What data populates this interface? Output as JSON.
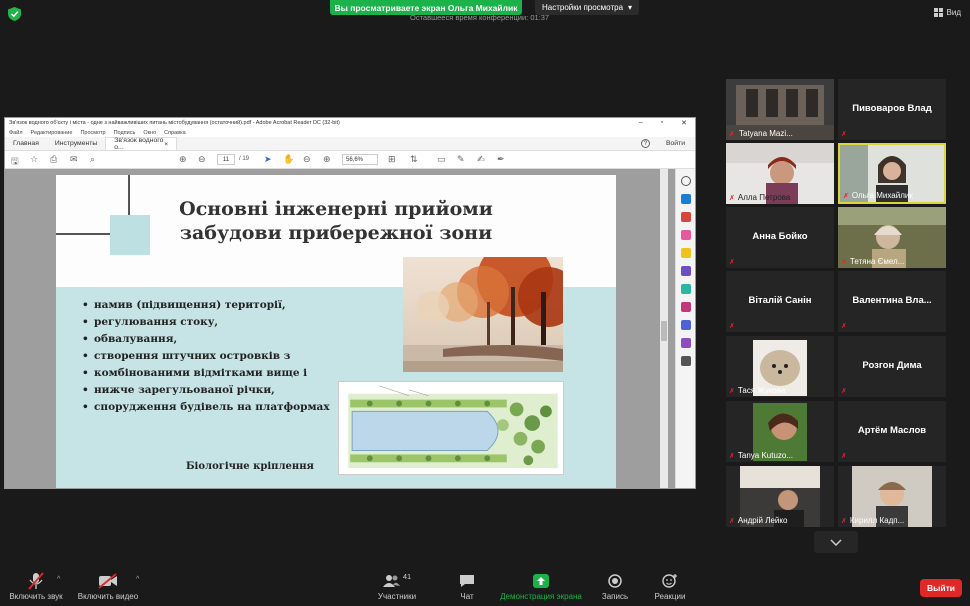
{
  "top": {
    "sharing_banner": "Вы просматриваете экран Ольга Михайлик",
    "view_options": "Настройки просмотра",
    "remaining_time": "Оставшееся время конференции: 01:37",
    "view_label": "Вид"
  },
  "acrobat": {
    "title": "Зв'язок водного об'єкту і міста - одне з найважливіших питань містобудування (остаточний).pdf - Adobe Acrobat Reader DC (32-bit)",
    "menu": [
      "Файл",
      "Редактирование",
      "Просмотр",
      "Подпись",
      "Окно",
      "Справка"
    ],
    "tabs": {
      "home": "Главная",
      "tools": "Инструменты",
      "doc": "Зв'язок водного о..."
    },
    "signin": "Войти",
    "page_current": "11",
    "page_total": "/ 19",
    "zoom": "56,6%",
    "slide": {
      "title_line1": "Основні інженерні прийоми",
      "title_line2": "забудови прибережної зони",
      "bullets": [
        "намив (підвищення) території,",
        "регулювання стоку,",
        "обвалування,",
        "створення штучних островків з",
        "комбінованими відмітками вище і",
        "нижче зарегульованої річки,",
        "спорудження будівель на платформах"
      ],
      "caption": "Біологічне кріплення"
    }
  },
  "participants": [
    {
      "name": "Tatyana Mazi..."
    },
    {
      "name": "Пивоваров Влад"
    },
    {
      "name": "Алла Петрова"
    },
    {
      "name": "Ольга Михайлик"
    },
    {
      "name": "Анна Бойко"
    },
    {
      "name": "Тетяна Ємел..."
    },
    {
      "name": "Віталій Санін"
    },
    {
      "name": "Валентина  Вла..."
    },
    {
      "name": "Тася Жукова"
    },
    {
      "name": "Розгон Дима"
    },
    {
      "name": "Tanya Kutuzo..."
    },
    {
      "name": "Артём Маслов"
    },
    {
      "name": "Андрій Лейко"
    },
    {
      "name": "Кирилл Кадп..."
    }
  ],
  "toolbar": {
    "mute": "Включить звук",
    "video": "Включить видео",
    "participants": "Участники",
    "participants_count": "41",
    "chat": "Чат",
    "share": "Демонстрация экрана",
    "record": "Запись",
    "reactions": "Реакции",
    "leave": "Выйти"
  },
  "colors": {
    "share_green": "#1bb24a",
    "leave_red": "#e02828",
    "active_speaker": "#d8d63a"
  }
}
